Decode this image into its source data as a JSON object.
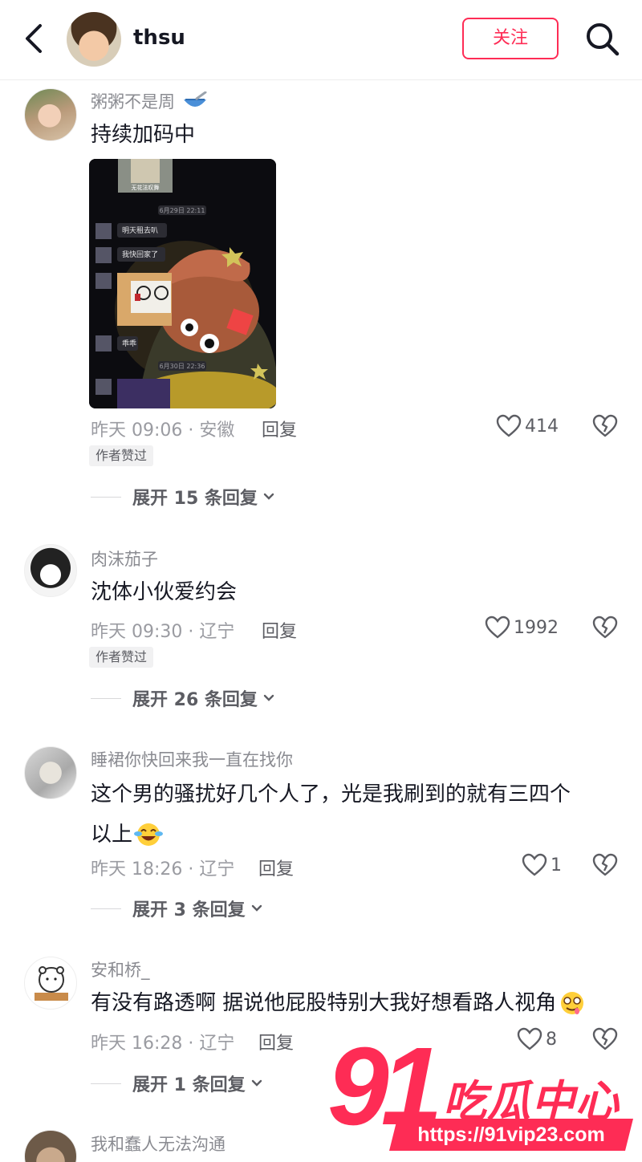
{
  "header": {
    "username": "thsu",
    "follow_label": "关注"
  },
  "comments": [
    {
      "username": "粥粥不是周",
      "text": "持续加码中",
      "time_location": "昨天 09:06 · 安徽",
      "reply_label": "回复",
      "likes": "414",
      "badge": "作者赞过",
      "expand_label": "展开 15 条回复",
      "photo": {
        "dates": [
          "6月29日 22:11",
          "6月30日 22:36"
        ],
        "messages": [
          "明天租去叭",
          "我快回家了",
          "乖乖"
        ],
        "sticker_caption": "无花法叹舞"
      }
    },
    {
      "username": "肉沫茄子",
      "text": "沈体小伙爱约会",
      "time_location": "昨天 09:30 · 辽宁",
      "reply_label": "回复",
      "likes": "1992",
      "badge": "作者赞过",
      "expand_label": "展开 26 条回复"
    },
    {
      "username": "睡裙你快回来我一直在找你",
      "text_line1": "这个男的骚扰好几个人了，光是我刷到的就有三四个",
      "text_line2": "以上",
      "time_location": "昨天 18:26 · 辽宁",
      "reply_label": "回复",
      "likes": "1",
      "expand_label": "展开 3 条回复"
    },
    {
      "username": "安和桥_",
      "text": "有没有路透啊 据说他屁股特别大我好想看路人视角",
      "time_location": "昨天 16:28 · 辽宁",
      "reply_label": "回复",
      "likes": "8",
      "expand_label": "展开 1 条回复"
    },
    {
      "username": "我和蠢人无法沟通"
    }
  ],
  "watermark": {
    "number": "91",
    "title": "吃瓜中心",
    "url": "https://91vip23.com"
  },
  "colors": {
    "accent": "#fe2c55",
    "secondary_text": "#8a8b91"
  }
}
